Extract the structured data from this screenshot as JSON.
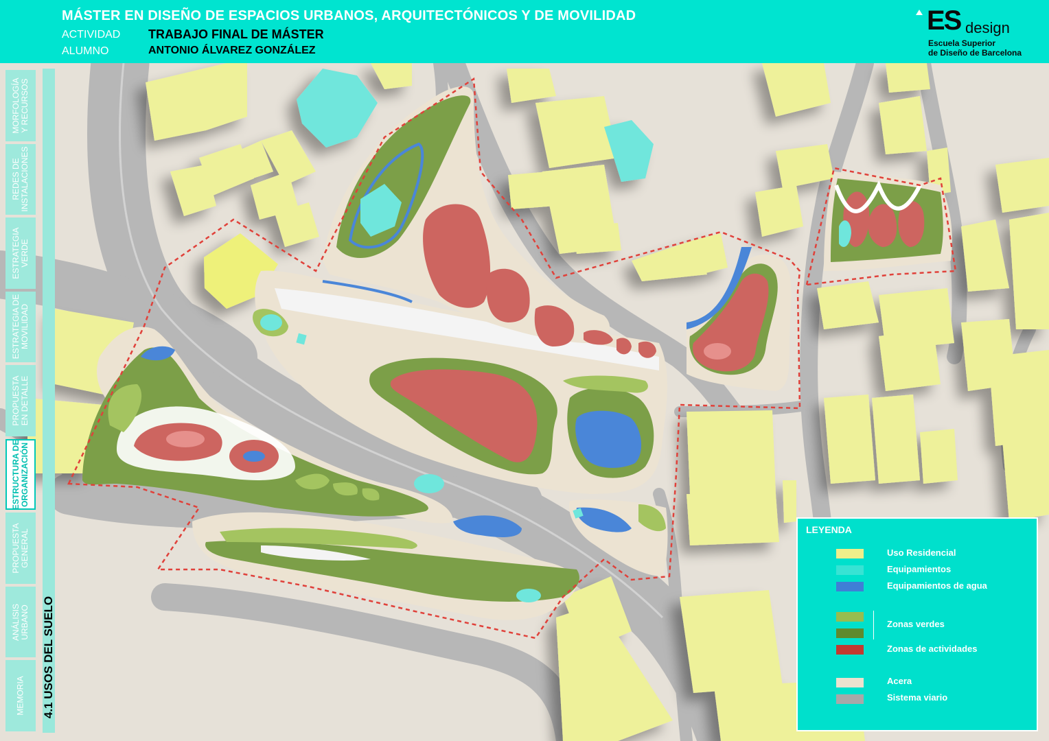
{
  "header": {
    "title": "MÁSTER EN DISEÑO DE ESPACIOS URBANOS, ARQUITECTÓNICOS Y DE MOVILIDAD",
    "actividad_label": "ACTIVIDAD",
    "actividad_value": "TRABAJO FINAL DE MÁSTER",
    "alumno_label": "ALUMNO",
    "alumno_value": "ANTONIO ÁLVAREZ GONZÁLEZ"
  },
  "logo": {
    "es": "ES",
    "design": "design",
    "line1": "Escuela Superior",
    "line2": "de Diseño de Barcelona"
  },
  "sidebar": {
    "items": [
      {
        "label": "MORFOLOGÍA\nY RECURSOS",
        "active": false
      },
      {
        "label": "REDES DE\nINSTALACIONES",
        "active": false
      },
      {
        "label": "ESTRATEGIA\nVERDE",
        "active": false
      },
      {
        "label": "ESTRATEGIA DE\nMOVILIDAD",
        "active": false
      },
      {
        "label": "PROPUESTA\nEN DETALLE",
        "active": false
      },
      {
        "label": "ESTRUCTURA DE\nORGANIZACIÓN",
        "active": true
      },
      {
        "label": "PROPUESTA\nGENERAL",
        "active": false
      },
      {
        "label": "ANÁLISIS\nURBANO",
        "active": false
      },
      {
        "label": "MEMORIA",
        "active": false
      }
    ]
  },
  "section_title": "4.1 USOS DEL SUELO",
  "legend": {
    "title": "LEYENDA",
    "items": [
      {
        "label": "Uso Residencial",
        "color": "#f0ef8a"
      },
      {
        "label": "Equipamientos",
        "color": "#37e3d4"
      },
      {
        "label": "Equipamientos de agua",
        "color": "#3f7fd6"
      },
      {
        "label": "Zonas verdes",
        "color": "#97bd4f",
        "color2": "#5f8a2e"
      },
      {
        "label": "Zonas de actividades",
        "color": "#c23a30"
      },
      {
        "label": "Acera",
        "color": "#ece2cf"
      },
      {
        "label": "Sistema viario",
        "color": "#a8a8a8"
      }
    ]
  },
  "colors": {
    "header_bg": "#00e4d0",
    "residential": "#eef19a",
    "equipment": "#6fe6dc",
    "water": "#4a86d8",
    "green_light": "#a4c460",
    "green_dark": "#7c9f48",
    "activity": "#cd6560",
    "sidewalk": "#ece3d2",
    "road": "#b6b6b6",
    "ground": "#e6e1d8"
  }
}
